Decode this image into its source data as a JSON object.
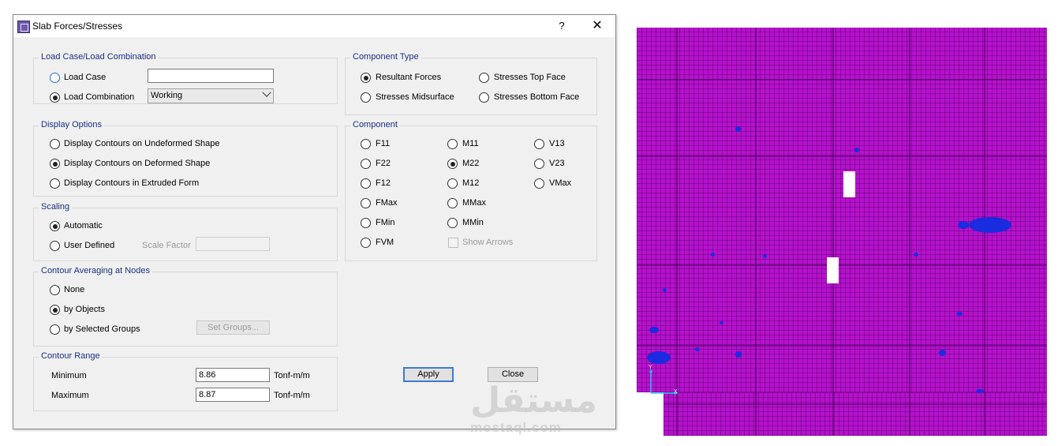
{
  "dialog": {
    "title": "Slab Forces/Stresses",
    "help_label": "?",
    "close_label": "✕"
  },
  "load_case": {
    "title": "Load Case/Load Combination",
    "options": [
      {
        "label": "Load Case",
        "selected": false
      },
      {
        "label": "Load Combination",
        "selected": true
      }
    ],
    "load_case_value": "",
    "combination_value": "Working"
  },
  "display_options": {
    "title": "Display Options",
    "options": [
      {
        "label": "Display Contours on Undeformed Shape",
        "selected": false
      },
      {
        "label": "Display Contours on Deformed Shape",
        "selected": true
      },
      {
        "label": "Display Contours in Extruded Form",
        "selected": false
      }
    ]
  },
  "scaling": {
    "title": "Scaling",
    "options": [
      {
        "label": "Automatic",
        "selected": true
      },
      {
        "label": "User Defined",
        "selected": false
      }
    ],
    "scale_factor_label": "Scale Factor",
    "scale_factor_value": ""
  },
  "averaging": {
    "title": "Contour Averaging at Nodes",
    "options": [
      {
        "label": "None",
        "selected": false
      },
      {
        "label": "by Objects",
        "selected": true
      },
      {
        "label": "by Selected Groups",
        "selected": false
      }
    ],
    "set_groups_label": "Set Groups..."
  },
  "contour_range": {
    "title": "Contour Range",
    "min_label": "Minimum",
    "min_value": "8.86",
    "max_label": "Maximum",
    "max_value": "8.87",
    "unit": "Tonf-m/m"
  },
  "component_type": {
    "title": "Component Type",
    "options": [
      {
        "label": "Resultant Forces",
        "selected": true
      },
      {
        "label": "Stresses Top Face",
        "selected": false
      },
      {
        "label": "Stresses Midsurface",
        "selected": false
      },
      {
        "label": "Stresses Bottom Face",
        "selected": false
      }
    ]
  },
  "component": {
    "title": "Component",
    "col1": [
      {
        "label": "F11",
        "selected": false
      },
      {
        "label": "F22",
        "selected": false
      },
      {
        "label": "F12",
        "selected": false
      },
      {
        "label": "FMax",
        "selected": false
      },
      {
        "label": "FMin",
        "selected": false
      },
      {
        "label": "FVM",
        "selected": false
      }
    ],
    "col2": [
      {
        "label": "M11",
        "selected": false
      },
      {
        "label": "M22",
        "selected": true
      },
      {
        "label": "M12",
        "selected": false
      },
      {
        "label": "MMax",
        "selected": false
      },
      {
        "label": "MMin",
        "selected": false
      }
    ],
    "col3": [
      {
        "label": "V13",
        "selected": false
      },
      {
        "label": "V23",
        "selected": false
      },
      {
        "label": "VMax",
        "selected": false
      }
    ],
    "show_arrows_label": "Show Arrows",
    "show_arrows_checked": false
  },
  "buttons": {
    "apply": "Apply",
    "close": "Close"
  },
  "watermark": {
    "arabic": "مستقل",
    "latin": "mostaql.com"
  },
  "model_view": {
    "axis_y": "Y",
    "axis_x": "X",
    "colors": {
      "slab": "#b711cc",
      "contour_low": "#1a2be0"
    }
  }
}
